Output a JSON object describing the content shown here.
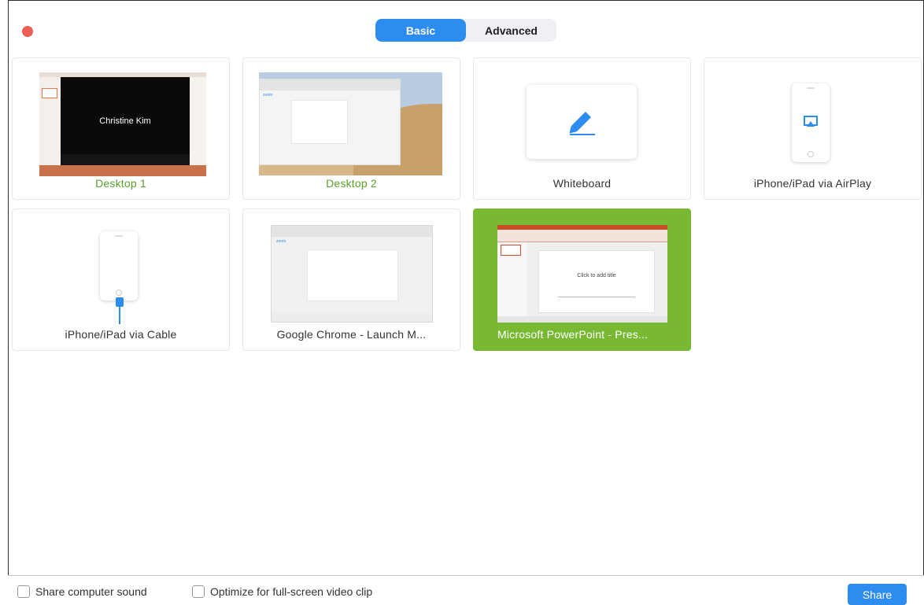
{
  "window": {
    "close_color": "#ec5f57"
  },
  "tabs": [
    {
      "label": "Basic",
      "active": true
    },
    {
      "label": "Advanced",
      "active": false
    }
  ],
  "sources": [
    {
      "label": "Desktop 1",
      "label_color": "#5aa02c",
      "thumbnail_text": "Christine Kim"
    },
    {
      "label": "Desktop 2",
      "label_color": "#5aa02c"
    },
    {
      "label": "Whiteboard",
      "icon": "pen-icon"
    },
    {
      "label": "iPhone/iPad via AirPlay",
      "icon": "airplay-icon"
    },
    {
      "label": "iPhone/iPad via Cable",
      "icon": "cable-icon"
    },
    {
      "label": "Google Chrome - Launch M..."
    },
    {
      "label": "Microsoft PowerPoint - Pres...",
      "selected": true,
      "thumbnail_text": "Click to add title"
    }
  ],
  "footer": {
    "share_sound_label": "Share computer sound",
    "share_sound_checked": false,
    "optimize_label": "Optimize for full-screen video clip",
    "optimize_checked": false,
    "share_button": "Share"
  },
  "colors": {
    "accent": "#2d8cf0",
    "selected": "#78b833"
  }
}
